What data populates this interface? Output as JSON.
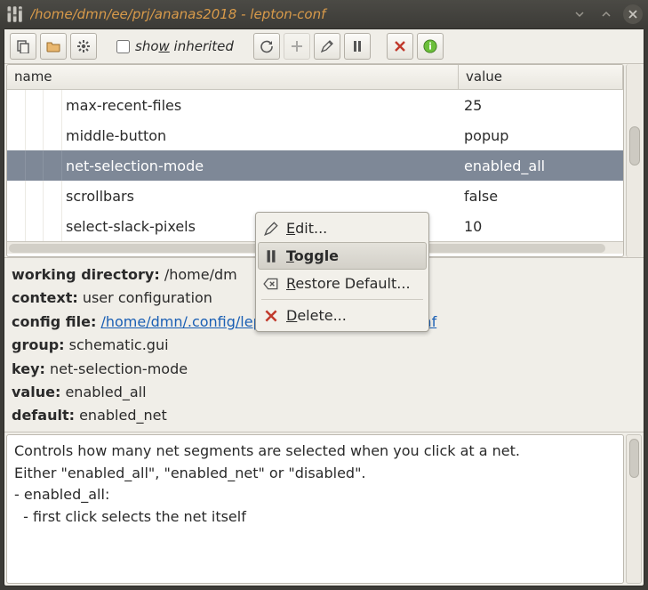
{
  "window": {
    "title": "/home/dmn/ee/prj/ananas2018 - lepton-conf"
  },
  "toolbar": {
    "show_inherited_prefix": "sho",
    "show_inherited_ul": "w",
    "show_inherited_suffix": " inherited"
  },
  "tree": {
    "columns": {
      "name": "name",
      "value": "value"
    },
    "rows": [
      {
        "name": "max-recent-files",
        "value": "25",
        "selected": false
      },
      {
        "name": "middle-button",
        "value": "popup",
        "selected": false
      },
      {
        "name": "net-selection-mode",
        "value": "enabled_all",
        "selected": true
      },
      {
        "name": "scrollbars",
        "value": "false",
        "selected": false
      },
      {
        "name": "select-slack-pixels",
        "value": "10",
        "selected": false
      }
    ]
  },
  "details": {
    "workdir_label": "working directory:",
    "workdir_value": "/home/dm",
    "context_label": "context:",
    "context_value": "user configuration",
    "configfile_label": "config file:",
    "configfile_link": "/home/dmn/.config/lepton-eda/lepton-user.conf",
    "group_label": "group:",
    "group_value": "schematic.gui",
    "key_label": "key:",
    "key_value": "net-selection-mode",
    "value_label": "value:",
    "value_value": "enabled_all",
    "default_label": "default:",
    "default_value": "enabled_net"
  },
  "description": {
    "line1": "Controls how many net segments are selected when you click at a net.",
    "line2": "Either \"enabled_all\", \"enabled_net\" or \"disabled\".",
    "line3": "- enabled_all:",
    "line4": "  - first click selects the net itself"
  },
  "context_menu": {
    "edit_ul": "E",
    "edit_rest": "dit...",
    "toggle_ul": "T",
    "toggle_rest": "oggle",
    "restore_ul": "R",
    "restore_rest": "estore Default...",
    "delete_ul": "D",
    "delete_rest": "elete..."
  }
}
